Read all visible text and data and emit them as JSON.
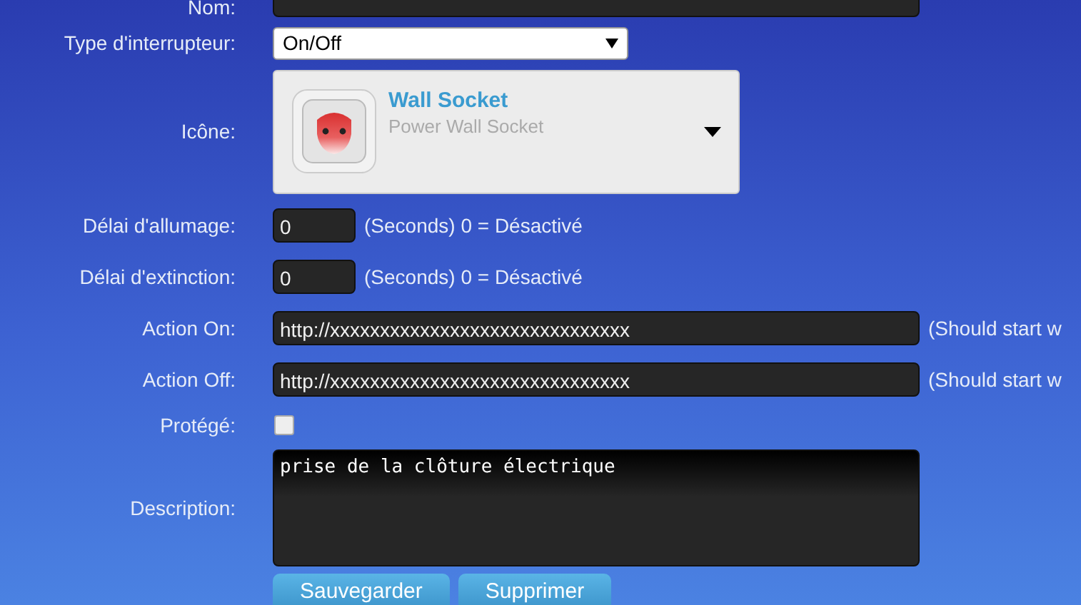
{
  "name_row": {
    "label": "Nom:"
  },
  "switch_type": {
    "label": "Type d'interrupteur:",
    "value": "On/Off"
  },
  "icon": {
    "label": "Icône:",
    "title": "Wall Socket",
    "subtitle": "Power Wall Socket"
  },
  "delays": [
    {
      "label": "Délai d'allumage:",
      "value": "0",
      "hint": "(Seconds) 0 = Désactivé"
    },
    {
      "label": "Délai d'extinction:",
      "value": "0",
      "hint": "(Seconds) 0 = Désactivé"
    }
  ],
  "actions": [
    {
      "label": "Action On:",
      "value": "http://xxxxxxxxxxxxxxxxxxxxxxxxxxxxxx",
      "hint": "(Should start w"
    },
    {
      "label": "Action Off:",
      "value": "http://xxxxxxxxxxxxxxxxxxxxxxxxxxxxxx",
      "hint": "(Should start w"
    }
  ],
  "protected": {
    "label": "Protégé:",
    "checked": false
  },
  "description": {
    "label": "Description:",
    "value": "prise de la clôture électrique"
  },
  "buttons": [
    "Sauvegarder",
    "Supprimer"
  ]
}
